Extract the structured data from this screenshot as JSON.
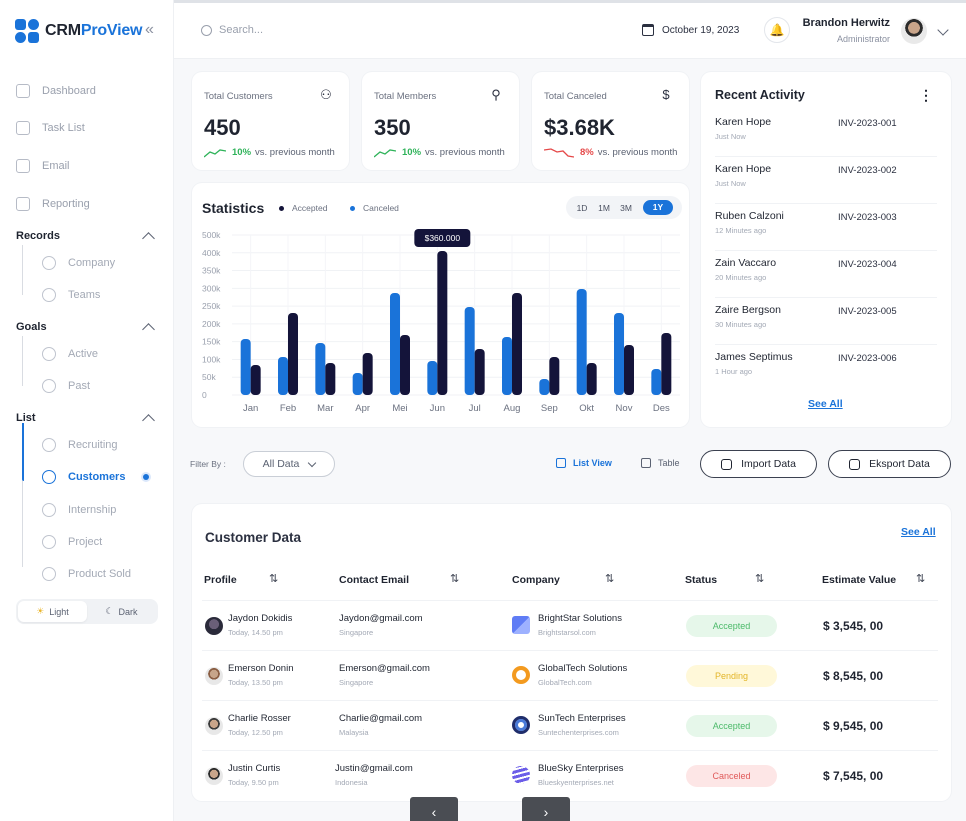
{
  "brand": {
    "prefix": "CRM",
    "suffix": "ProView",
    "accent": "#1a73d9"
  },
  "sidebar": {
    "collapse_icon": "«",
    "main_items": [
      {
        "label": "Dashboard",
        "icon": "grid-icon"
      },
      {
        "label": "Task List",
        "icon": "checklist-icon"
      },
      {
        "label": "Email",
        "icon": "mail-icon"
      },
      {
        "label": "Reporting",
        "icon": "document-icon"
      }
    ],
    "sections": [
      {
        "title": "Records",
        "items": [
          {
            "label": "Company",
            "icon": "building-icon"
          },
          {
            "label": "Teams",
            "icon": "team-icon"
          }
        ]
      },
      {
        "title": "Goals",
        "items": [
          {
            "label": "Active",
            "icon": "target-icon"
          },
          {
            "label": "Past",
            "icon": "history-icon"
          }
        ]
      },
      {
        "title": "List",
        "items": [
          {
            "label": "Recruiting",
            "icon": "badge-icon"
          },
          {
            "label": "Customers",
            "icon": "users-icon",
            "active": true
          },
          {
            "label": "Internship",
            "icon": "user-circle-icon"
          },
          {
            "label": "Project",
            "icon": "monitor-icon"
          },
          {
            "label": "Product Sold",
            "icon": "box-icon"
          }
        ]
      }
    ],
    "theme": {
      "light": "Light",
      "dark": "Dark"
    }
  },
  "header": {
    "search_placeholder": "Search...",
    "date": "October 19, 2023",
    "user": {
      "name": "Brandon Herwitz",
      "role": "Administrator"
    }
  },
  "kpis": [
    {
      "title": "Total Customers",
      "value": "450",
      "change": "10%",
      "direction": "up",
      "suffix": "vs. previous month",
      "icon": "users-icon"
    },
    {
      "title": "Total Members",
      "value": "350",
      "change": "10%",
      "direction": "up",
      "suffix": "vs. previous month",
      "icon": "user-search-icon"
    },
    {
      "title": "Total Canceled",
      "value": "$3.68K",
      "change": "8%",
      "direction": "down",
      "suffix": "vs. previous month",
      "icon": "dollar-icon"
    }
  ],
  "statistics": {
    "title": "Statistics",
    "ranges": [
      "1D",
      "1M",
      "3M",
      "1Y"
    ],
    "selected_range": "1Y",
    "tooltip": "$360.000"
  },
  "chart_data": {
    "type": "bar",
    "categories": [
      "Jan",
      "Feb",
      "Mar",
      "Apr",
      "Mei",
      "Jun",
      "Jul",
      "Aug",
      "Sep",
      "Okt",
      "Nov",
      "Des"
    ],
    "series": [
      {
        "name": "Accepted",
        "color": "#1a73d9",
        "values": [
          140,
          95,
          130,
          55,
          255,
          85,
          220,
          145,
          40,
          265,
          205,
          65
        ]
      },
      {
        "name": "Canceled",
        "color": "#14143a",
        "values": [
          75,
          205,
          80,
          105,
          150,
          360,
          115,
          255,
          95,
          80,
          125,
          155
        ]
      }
    ],
    "yticks": [
      "0",
      "50k",
      "100k",
      "150k",
      "200k",
      "250k",
      "300k",
      "350k",
      "400k",
      "500k"
    ],
    "ylim": [
      0,
      400
    ],
    "highlight": {
      "category": "Jun",
      "series": "Canceled"
    },
    "grid": true,
    "legend_position": "top"
  },
  "recent_activity": {
    "title": "Recent Activity",
    "items": [
      {
        "name": "Karen Hope",
        "time": "Just Now",
        "invoice": "INV-2023-001"
      },
      {
        "name": "Karen Hope",
        "time": "Just Now",
        "invoice": "INV-2023-002"
      },
      {
        "name": "Ruben Calzoni",
        "time": "12 Minutes ago",
        "invoice": "INV-2023-003"
      },
      {
        "name": "Zain Vaccaro",
        "time": "20 Minutes ago",
        "invoice": "INV-2023-004"
      },
      {
        "name": "Zaire Bergson",
        "time": "30 Minutes ago",
        "invoice": "INV-2023-005"
      },
      {
        "name": "James Septimus",
        "time": "1 Hour ago",
        "invoice": "INV-2023-006"
      }
    ],
    "see_all": "See All"
  },
  "filter": {
    "label": "Filter By :",
    "selected": "All Data",
    "list_view": "List View",
    "table_view": "Table",
    "import": "Import Data",
    "export": "Eksport Data"
  },
  "customer_data": {
    "title": "Customer Data",
    "see_all": "See All",
    "columns": [
      "Profile",
      "Contact Email",
      "Company",
      "Status",
      "Estimate Value"
    ],
    "rows": [
      {
        "name": "Jaydon Dokidis",
        "when": "Today, 14.50 pm",
        "email": "Jaydon@gmail.com",
        "location": "Singapore",
        "company": "BrightStar Solutions",
        "domain": "Brightstarsol.com",
        "status": "Accepted",
        "value": "$ 3,545, 00"
      },
      {
        "name": "Emerson Donin",
        "when": "Today, 13.50 pm",
        "email": "Emerson@gmail.com",
        "location": "Singapore",
        "company": "GlobalTech Solutions",
        "domain": "GlobalTech.com",
        "status": "Pending",
        "value": "$ 8,545, 00"
      },
      {
        "name": "Charlie Rosser",
        "when": "Today, 12.50 pm",
        "email": "Charlie@gmail.com",
        "location": "Malaysia",
        "company": "SunTech Enterprises",
        "domain": "Suntechenterprises.com",
        "status": "Accepted",
        "value": "$ 9,545, 00"
      },
      {
        "name": "Justin Curtis",
        "when": "Today, 9.50 pm",
        "email": "Justin@gmail.com",
        "location": "Indonesia",
        "company": "BlueSky Enterprises",
        "domain": "Blueskyenterprises.net",
        "status": "Canceled",
        "value": "$ 7,545, 00"
      }
    ],
    "status_colors": {
      "Accepted": {
        "bg": "#e6f7ea",
        "fg": "#4cba6a"
      },
      "Pending": {
        "bg": "#fff8d9",
        "fg": "#e3b528"
      },
      "Canceled": {
        "bg": "#fde6e6",
        "fg": "#e05a5a"
      }
    }
  },
  "pager": {
    "prev": "‹",
    "next": "›"
  }
}
